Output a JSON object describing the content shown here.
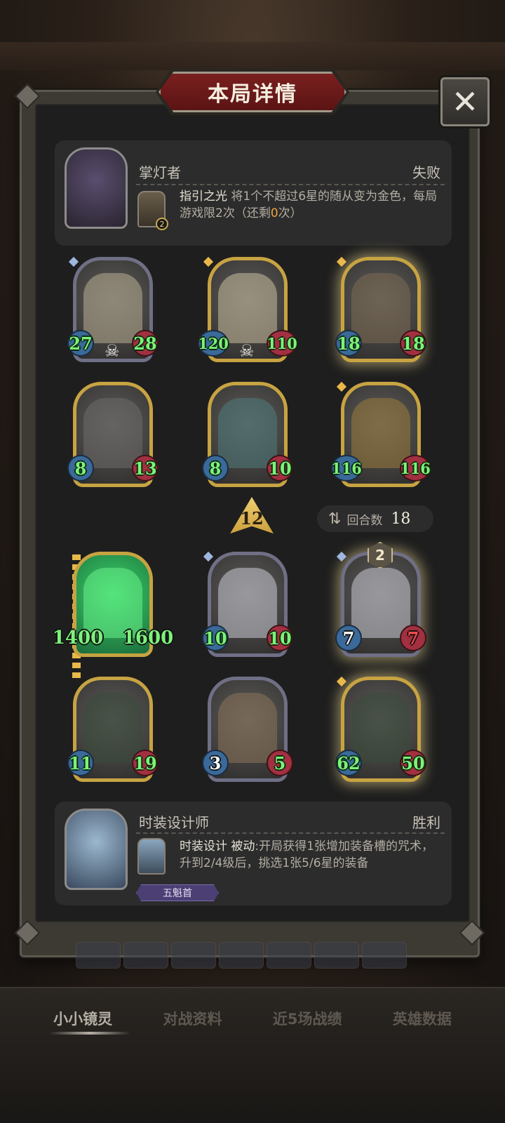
{
  "title": "本局详情",
  "close_icon": "✕",
  "top_hero": {
    "name": "掌灯者",
    "result": "失败",
    "skill_name": "指引之光",
    "skill_desc_a": " 将1个不超过6星的随从变为金色，每局游戏限2次（还剩",
    "skill_remaining": "0",
    "skill_desc_b": "次）",
    "skill_badge": "2"
  },
  "top_board": [
    {
      "attack": "27",
      "health": "28",
      "gold": false,
      "icon": "skull-icon"
    },
    {
      "attack": "120",
      "health": "110",
      "gold": true,
      "icon": "skull-icon"
    },
    {
      "attack": "18",
      "health": "18",
      "gold": true
    },
    {
      "attack": "8",
      "health": "13",
      "gold": true
    },
    {
      "attack": "8",
      "health": "10",
      "gold": true
    },
    {
      "attack": "116",
      "health": "116",
      "gold": true
    }
  ],
  "level": "12",
  "round": {
    "label": "回合数",
    "value": "18"
  },
  "bottom_board": [
    {
      "attack": "1400",
      "health": "1600",
      "gold": true
    },
    {
      "attack": "10",
      "health": "10",
      "gold": false
    },
    {
      "attack": "7",
      "health": "7",
      "gold": false,
      "tier": "2"
    },
    {
      "attack": "11",
      "health": "19",
      "gold": true
    },
    {
      "attack": "3",
      "health": "5",
      "gold": false
    },
    {
      "attack": "62",
      "health": "50",
      "gold": true
    }
  ],
  "bottom_hero": {
    "name": "时装设计师",
    "result": "胜利",
    "skill_name": "时装设计",
    "skill_type": "被动",
    "skill_desc": ":开局获得1张增加装备槽的咒术，升到2/4级后，挑选1张5/6星的装备",
    "rank": "五魁首"
  },
  "tabs": [
    "小小镜灵",
    "对战资料",
    "近5场战绩",
    "英雄数据"
  ],
  "colors": {
    "panel_bg": "#1e1e1e",
    "banner_red": "#7a1f1f",
    "stat_green": "#7cf27a",
    "gold_frame": "#c7a342",
    "silver_frame": "#6f6f86"
  }
}
